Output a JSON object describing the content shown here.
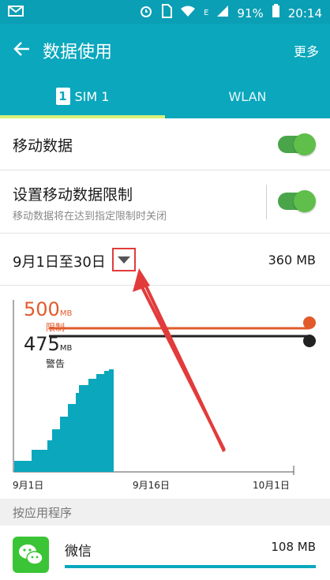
{
  "status_bar": {
    "battery": "91%",
    "time": "20:14",
    "network": "E",
    "icons": [
      "mail-icon",
      "alarm-icon",
      "sim-icon",
      "wifi-icon",
      "signal-icon",
      "battery-icon"
    ]
  },
  "app_bar": {
    "title": "数据使用",
    "more": "更多",
    "back_icon": "back-arrow-icon"
  },
  "tabs": [
    {
      "badge": "1",
      "label": "SIM 1",
      "selected": true
    },
    {
      "label": "WLAN",
      "selected": false
    }
  ],
  "mobile_data": {
    "label": "移动数据",
    "enabled": true
  },
  "data_limit": {
    "label": "设置移动数据限制",
    "sub": "移动数据将在达到指定限制时关闭",
    "enabled": true
  },
  "period": {
    "label": "9月1日至30日",
    "usage": "360 MB"
  },
  "chart": {
    "limit_value": "500",
    "limit_unit": "MB",
    "limit_label": "限制",
    "warn_value": "475",
    "warn_unit": "MB",
    "warn_label": "警告",
    "x_labels": [
      "9月1日",
      "9月16日",
      "10月1日"
    ]
  },
  "apps_section": {
    "label": "按应用程序"
  },
  "app": {
    "name": "微信",
    "usage": "108 MB",
    "usage_fraction": 1.0
  },
  "colors": {
    "accent": "#0aa7bd",
    "toggle": "#5fbf4a",
    "limit": "#e25a2c",
    "highlight": "#e23b3b"
  }
}
